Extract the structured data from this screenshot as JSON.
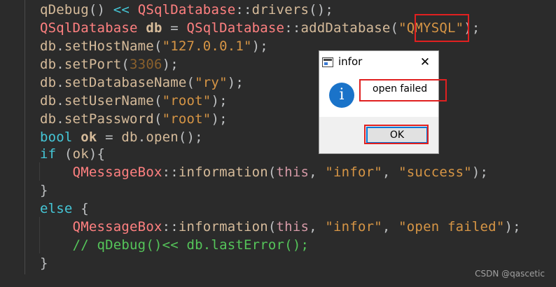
{
  "code": {
    "lines": [
      [
        {
          "c": "c-fn",
          "t": "qDebug"
        },
        {
          "c": "c-plain",
          "t": "() "
        },
        {
          "c": "c-kw",
          "t": "<<"
        },
        {
          "c": "c-plain",
          "t": " "
        },
        {
          "c": "c-cls",
          "t": "QSqlDatabase"
        },
        {
          "c": "c-plain",
          "t": "::"
        },
        {
          "c": "c-fn",
          "t": "drivers"
        },
        {
          "c": "c-plain",
          "t": "();"
        }
      ],
      [
        {
          "c": "c-cls",
          "t": "QSqlDatabase"
        },
        {
          "c": "c-plain",
          "t": " "
        },
        {
          "c": "c-bold",
          "t": "db"
        },
        {
          "c": "c-plain",
          "t": " = "
        },
        {
          "c": "c-cls",
          "t": "QSqlDatabase"
        },
        {
          "c": "c-plain",
          "t": "::"
        },
        {
          "c": "c-fn",
          "t": "addDatabase"
        },
        {
          "c": "c-plain",
          "t": "("
        },
        {
          "c": "c-str",
          "t": "\"QMYSQL\""
        },
        {
          "c": "c-plain",
          "t": ");"
        }
      ],
      [
        {
          "c": "c-var",
          "t": "db"
        },
        {
          "c": "c-plain",
          "t": "."
        },
        {
          "c": "c-fn",
          "t": "setHostName"
        },
        {
          "c": "c-plain",
          "t": "("
        },
        {
          "c": "c-str",
          "t": "\"127.0.0.1\""
        },
        {
          "c": "c-plain",
          "t": ");"
        }
      ],
      [
        {
          "c": "c-var",
          "t": "db"
        },
        {
          "c": "c-plain",
          "t": "."
        },
        {
          "c": "c-fn",
          "t": "setPort"
        },
        {
          "c": "c-plain",
          "t": "("
        },
        {
          "c": "c-num",
          "t": "3306"
        },
        {
          "c": "c-plain",
          "t": ");"
        }
      ],
      [
        {
          "c": "c-var",
          "t": "db"
        },
        {
          "c": "c-plain",
          "t": "."
        },
        {
          "c": "c-fn",
          "t": "setDatabaseName"
        },
        {
          "c": "c-plain",
          "t": "("
        },
        {
          "c": "c-str",
          "t": "\"ry\""
        },
        {
          "c": "c-plain",
          "t": ");"
        }
      ],
      [
        {
          "c": "c-var",
          "t": "db"
        },
        {
          "c": "c-plain",
          "t": "."
        },
        {
          "c": "c-fn",
          "t": "setUserName"
        },
        {
          "c": "c-plain",
          "t": "("
        },
        {
          "c": "c-str",
          "t": "\"root\""
        },
        {
          "c": "c-plain",
          "t": ");"
        }
      ],
      [
        {
          "c": "c-var",
          "t": "db"
        },
        {
          "c": "c-plain",
          "t": "."
        },
        {
          "c": "c-fn",
          "t": "setPassword"
        },
        {
          "c": "c-plain",
          "t": "("
        },
        {
          "c": "c-str",
          "t": "\"root\""
        },
        {
          "c": "c-plain",
          "t": ");"
        }
      ],
      [
        {
          "c": "c-kw",
          "t": "bool"
        },
        {
          "c": "c-plain",
          "t": " "
        },
        {
          "c": "c-bold",
          "t": "ok"
        },
        {
          "c": "c-plain",
          "t": " = "
        },
        {
          "c": "c-var",
          "t": "db"
        },
        {
          "c": "c-plain",
          "t": "."
        },
        {
          "c": "c-fn",
          "t": "open"
        },
        {
          "c": "c-plain",
          "t": "();"
        }
      ],
      [
        {
          "c": "c-kw",
          "t": "if"
        },
        {
          "c": "c-plain",
          "t": " ("
        },
        {
          "c": "c-var",
          "t": "ok"
        },
        {
          "c": "c-plain",
          "t": "){"
        }
      ],
      [
        {
          "c": "c-plain",
          "t": "    "
        },
        {
          "c": "c-cls",
          "t": "QMessageBox"
        },
        {
          "c": "c-plain",
          "t": "::"
        },
        {
          "c": "c-fn",
          "t": "information"
        },
        {
          "c": "c-plain",
          "t": "("
        },
        {
          "c": "c-this",
          "t": "this"
        },
        {
          "c": "c-plain",
          "t": ", "
        },
        {
          "c": "c-str",
          "t": "\"infor\""
        },
        {
          "c": "c-plain",
          "t": ", "
        },
        {
          "c": "c-str",
          "t": "\"success\""
        },
        {
          "c": "c-plain",
          "t": ");"
        }
      ],
      [
        {
          "c": "c-plain",
          "t": "}"
        }
      ],
      [
        {
          "c": "c-kw",
          "t": "else"
        },
        {
          "c": "c-plain",
          "t": " {"
        }
      ],
      [
        {
          "c": "c-plain",
          "t": "    "
        },
        {
          "c": "c-cls",
          "t": "QMessageBox"
        },
        {
          "c": "c-plain",
          "t": "::"
        },
        {
          "c": "c-fn",
          "t": "information"
        },
        {
          "c": "c-plain",
          "t": "("
        },
        {
          "c": "c-this",
          "t": "this"
        },
        {
          "c": "c-plain",
          "t": ", "
        },
        {
          "c": "c-str",
          "t": "\"infor\""
        },
        {
          "c": "c-plain",
          "t": ", "
        },
        {
          "c": "c-str",
          "t": "\"open failed\""
        },
        {
          "c": "c-plain",
          "t": ");"
        }
      ],
      [
        {
          "c": "c-plain",
          "t": "    "
        },
        {
          "c": "c-green",
          "t": "// qDebug()<< db.lastError();"
        }
      ],
      [
        {
          "c": "c-plain",
          "t": "}"
        }
      ]
    ]
  },
  "dialog": {
    "title": "infor",
    "close_glyph": "✕",
    "message": "open failed",
    "info_glyph": "i",
    "ok_label": "OK",
    "icons": {
      "app": "window-icon",
      "info": "information-icon",
      "close": "close-icon"
    }
  },
  "watermark": "CSDN @qascetic",
  "colors": {
    "editor_bg": "#2b2b2b",
    "highlight_box": "#e02020",
    "dialog_footer": "#f0f0f0",
    "info_icon": "#1a73c9",
    "ok_border": "#0078d7"
  }
}
